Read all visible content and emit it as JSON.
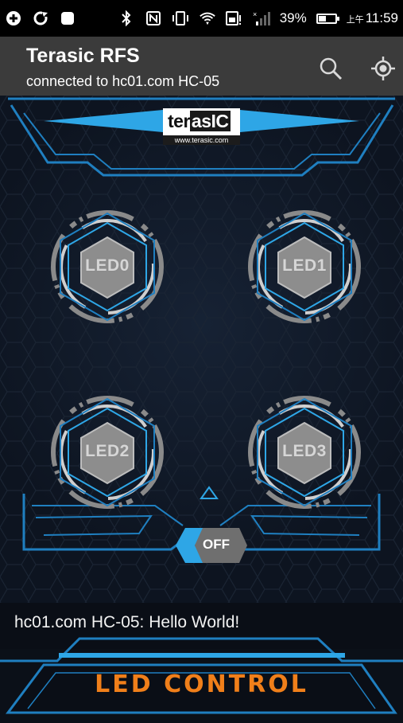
{
  "status_bar": {
    "battery_percent": "39%",
    "time_prefix": "上午",
    "time": "11:59",
    "icons": [
      "add-icon",
      "sync-icon",
      "notification-icon",
      "bluetooth-icon",
      "nfc-icon",
      "vibrate-icon",
      "wifi-icon",
      "sim-alert-icon",
      "signal-icon",
      "battery-icon"
    ]
  },
  "app_bar": {
    "title": "Terasic RFS",
    "subtitle": "connected to hc01.com HC-05",
    "actions": [
      "search-icon",
      "locate-icon"
    ]
  },
  "logo": {
    "brand_left": "ter",
    "brand_right": "asIC",
    "url": "www.terasic.com"
  },
  "leds": [
    {
      "label": "LED0"
    },
    {
      "label": "LED1"
    },
    {
      "label": "LED2"
    },
    {
      "label": "LED3"
    }
  ],
  "toggle": {
    "label": "OFF"
  },
  "message": {
    "text": "hc01.com HC-05:  Hello World!"
  },
  "footer": {
    "title": "LED CONTROL"
  },
  "colors": {
    "accent_blue": "#2ea6e6",
    "frame_blue": "#1f7fc0",
    "footer_orange": "#f07f1a",
    "appbar_bg": "#3b3b3b"
  }
}
